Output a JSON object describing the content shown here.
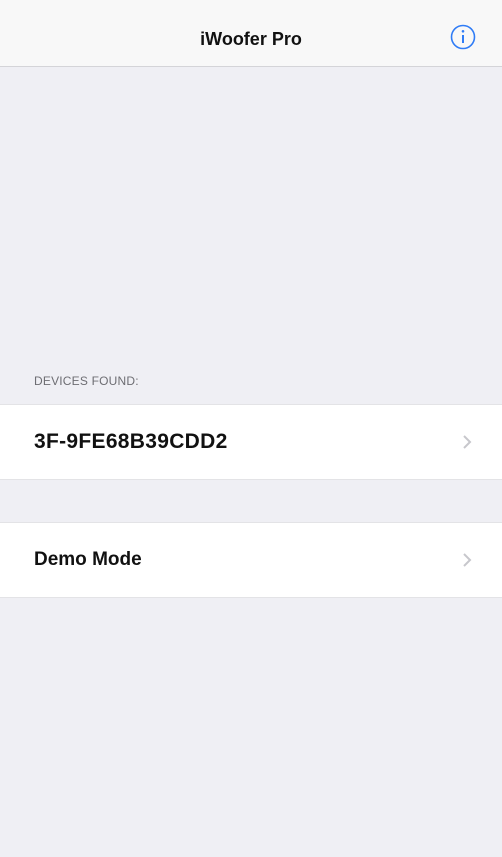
{
  "navbar": {
    "title": "iWoofer Pro",
    "info_icon": "info-circle-icon"
  },
  "devices": {
    "section_header": "DEVICES FOUND:",
    "items": [
      {
        "label": "3F-9FE68B39CDD2",
        "icon": "chevron-right-icon"
      }
    ]
  },
  "demo": {
    "label": "Demo Mode",
    "icon": "chevron-right-icon"
  },
  "colors": {
    "background": "#efeff4",
    "navbar": "#f8f8f8",
    "cell": "#ffffff",
    "tint": "#2f7cf6",
    "chevron": "#c7c7cc"
  }
}
